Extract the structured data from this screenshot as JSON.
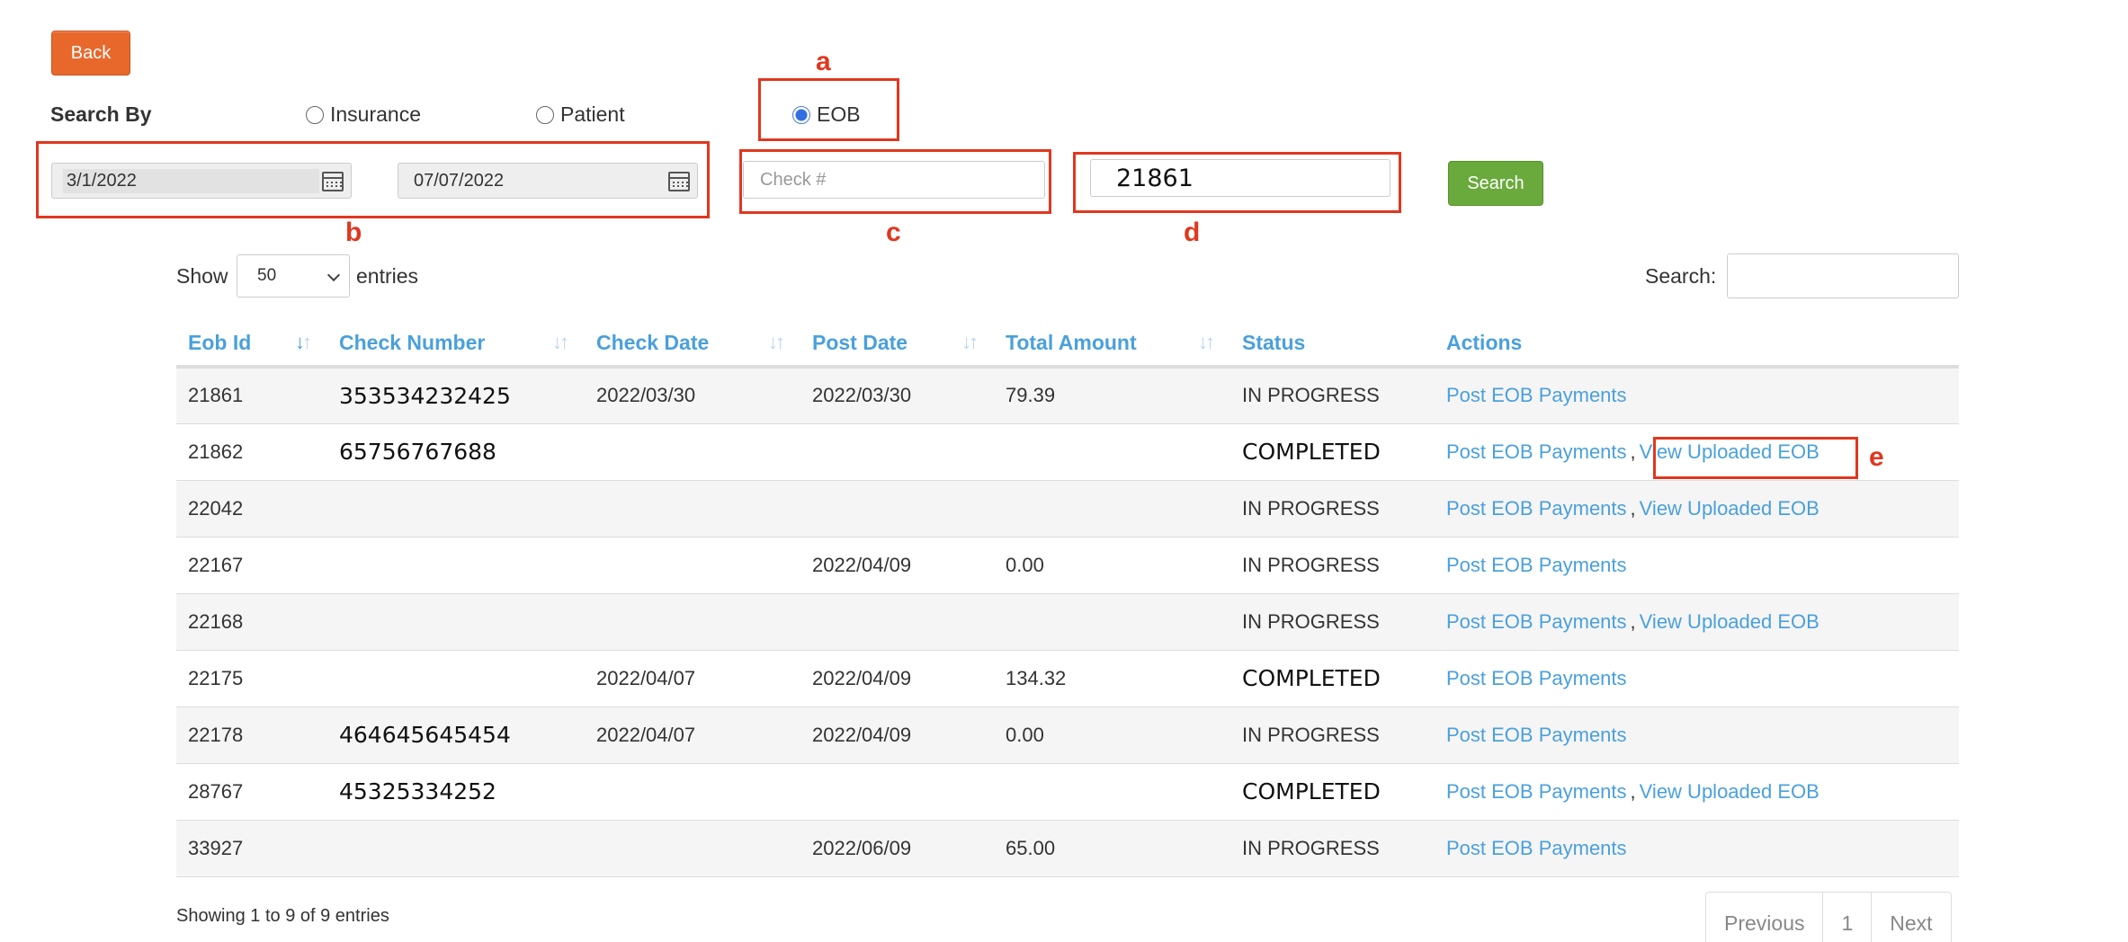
{
  "back_label": "Back",
  "search_by": {
    "label": "Search By",
    "options": [
      {
        "label": "Insurance",
        "checked": false
      },
      {
        "label": "Patient",
        "checked": false
      },
      {
        "label": "EOB",
        "checked": true
      }
    ]
  },
  "filters": {
    "date_from": "3/1/2022",
    "date_to": "07/07/2022",
    "check_placeholder": "Check #",
    "eob_value": "21861",
    "search_label": "Search"
  },
  "annotations": {
    "a": "a",
    "b": "b",
    "c": "c",
    "d": "d",
    "e": "e"
  },
  "length_menu": {
    "show": "Show",
    "value": "50",
    "entries": "entries"
  },
  "table_search_label": "Search:",
  "table": {
    "columns": [
      "Eob Id",
      "Check Number",
      "Check Date",
      "Post Date",
      "Total Amount",
      "Status",
      "Actions"
    ],
    "rows": [
      {
        "id": "21861",
        "check": "353534232425",
        "check_date": "2022/03/30",
        "post_date": "2022/03/30",
        "amount": "79.39",
        "status": "IN PROGRESS",
        "post": "Post EOB Payments",
        "view": ""
      },
      {
        "id": "21862",
        "check": "65756767688",
        "check_date": "",
        "post_date": "",
        "amount": "",
        "status": "COMPLETED",
        "post": "Post EOB Payments",
        "view": "View Uploaded EOB"
      },
      {
        "id": "22042",
        "check": "",
        "check_date": "",
        "post_date": "",
        "amount": "",
        "status": "IN PROGRESS",
        "post": "Post EOB Payments",
        "view": "View Uploaded EOB"
      },
      {
        "id": "22167",
        "check": "",
        "check_date": "",
        "post_date": "2022/04/09",
        "amount": "0.00",
        "status": "IN PROGRESS",
        "post": "Post EOB Payments",
        "view": ""
      },
      {
        "id": "22168",
        "check": "",
        "check_date": "",
        "post_date": "",
        "amount": "",
        "status": "IN PROGRESS",
        "post": "Post EOB Payments",
        "view": "View Uploaded EOB"
      },
      {
        "id": "22175",
        "check": "",
        "check_date": "2022/04/07",
        "post_date": "2022/04/09",
        "amount": "134.32",
        "status": "COMPLETED",
        "post": "Post EOB Payments",
        "view": ""
      },
      {
        "id": "22178",
        "check": "464645645454",
        "check_date": "2022/04/07",
        "post_date": "2022/04/09",
        "amount": "0.00",
        "status": "IN PROGRESS",
        "post": "Post EOB Payments",
        "view": ""
      },
      {
        "id": "28767",
        "check": "45325334252",
        "check_date": "",
        "post_date": "",
        "amount": "",
        "status": "COMPLETED",
        "post": "Post EOB Payments",
        "view": "View Uploaded EOB"
      },
      {
        "id": "33927",
        "check": "",
        "check_date": "",
        "post_date": "2022/06/09",
        "amount": "65.00",
        "status": "IN PROGRESS",
        "post": "Post EOB Payments",
        "view": ""
      }
    ]
  },
  "footer": {
    "info": "Showing 1 to 9 of 9 entries",
    "previous": "Previous",
    "page": "1",
    "next": "Next"
  }
}
